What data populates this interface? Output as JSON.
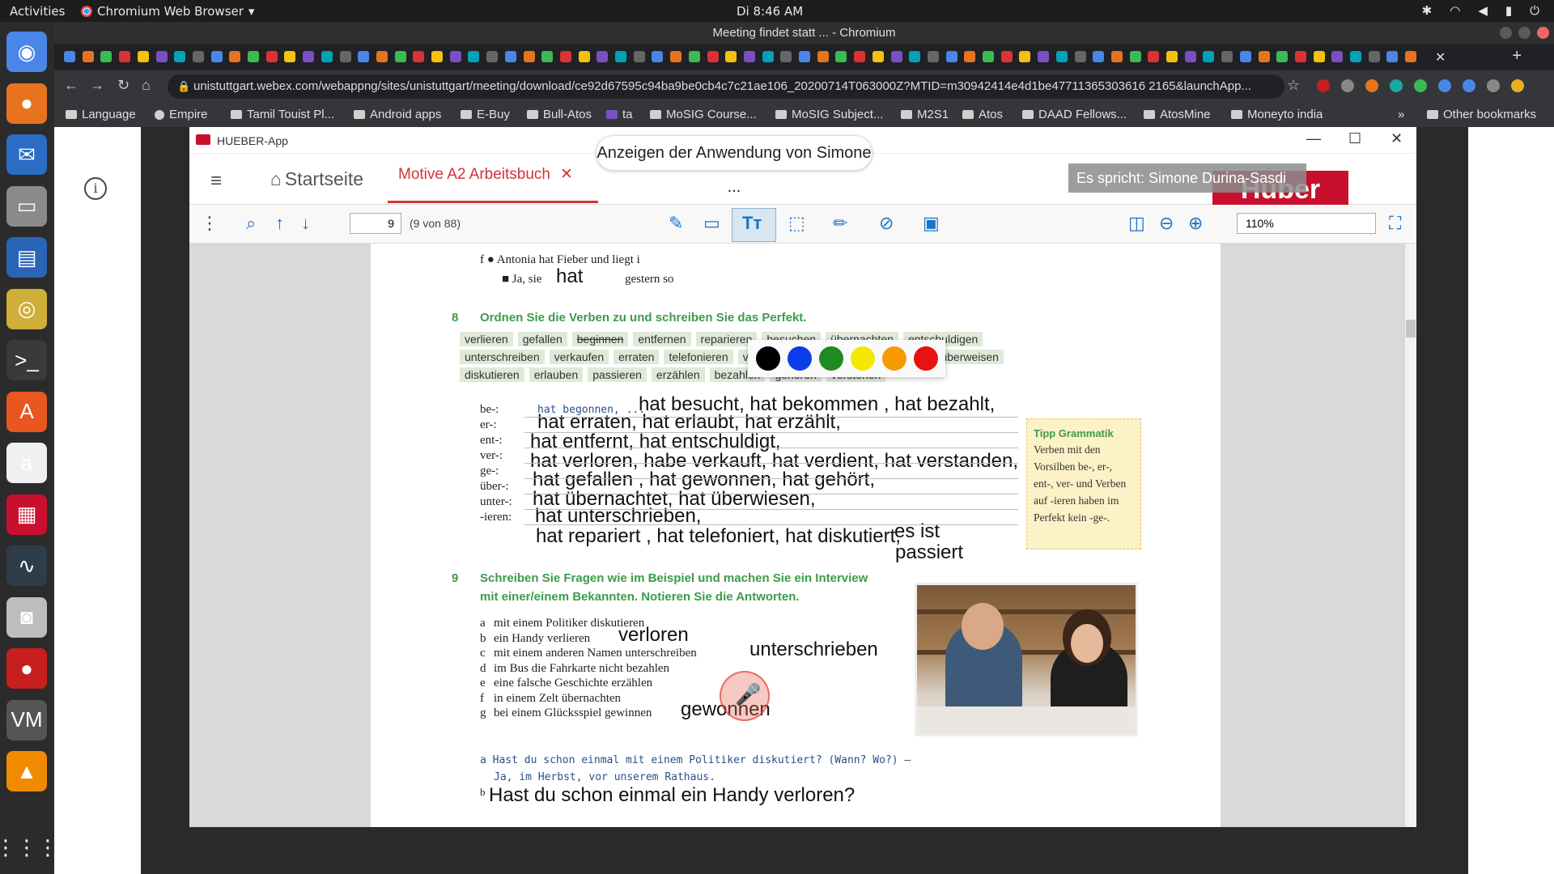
{
  "system": {
    "activities": "Activities",
    "app_name": "Chromium Web Browser",
    "app_dropdown": "▾",
    "clock": "Di  8:46 AM",
    "tray_icons": [
      "bluetooth-icon",
      "wifi-icon",
      "volume-icon",
      "battery-icon",
      "power-icon"
    ],
    "tray_glyphs": [
      "✱",
      "◠",
      "◀",
      "▮",
      "⏻"
    ]
  },
  "dock": {
    "items": [
      {
        "name": "chromium-icon",
        "glyph": "◉",
        "color": "#4a86e8"
      },
      {
        "name": "firefox-icon",
        "glyph": "●",
        "color": "#e8731f"
      },
      {
        "name": "thunderbird-icon",
        "glyph": "✉",
        "color": "#2b6cc4"
      },
      {
        "name": "files-icon",
        "glyph": "▭",
        "color": "#8a8a8a"
      },
      {
        "name": "writer-icon",
        "glyph": "▤",
        "color": "#2a64b8"
      },
      {
        "name": "rhythmbox-icon",
        "glyph": "◎",
        "color": "#cfae3a"
      },
      {
        "name": "terminal-icon",
        "glyph": ">_",
        "color": "#3a3a3a"
      },
      {
        "name": "software-center-icon",
        "glyph": "A",
        "color": "#e8571f"
      },
      {
        "name": "amazon-icon",
        "glyph": "a",
        "color": "#f0f0f0"
      },
      {
        "name": "screen-reader-icon",
        "glyph": "▦",
        "color": "#c8102e"
      },
      {
        "name": "system-monitor-icon",
        "glyph": "∿",
        "color": "#2f3d4a"
      },
      {
        "name": "camera-icon",
        "glyph": "◙",
        "color": "#bdbdbd"
      },
      {
        "name": "cherry-icon",
        "glyph": "●",
        "color": "#c81e1e"
      },
      {
        "name": "vmware-icon",
        "glyph": "VM",
        "color": "#555555"
      },
      {
        "name": "vlc-icon",
        "glyph": "▲",
        "color": "#f08a00"
      },
      {
        "name": "show-apps-icon",
        "glyph": "⋮⋮⋮",
        "color": "#2b2b2b"
      }
    ]
  },
  "browser": {
    "window_title": "Meeting findet statt ... - Chromium",
    "url": "unistuttgart.webex.com/webappng/sites/unistuttgart/meeting/download/ce92d67595c94ba9be0cb4c7c21ae106_20200714T063000Z?MTID=m30942414e4d1be47711365303616 2165&launchApp...",
    "new_tab": "+",
    "tab_close": "✕",
    "nav": {
      "back": "←",
      "forward": "→",
      "reload": "↻",
      "home": "⌂",
      "star": "☆",
      "lock": "🔒"
    },
    "bookmarks": [
      {
        "label": "Language"
      },
      {
        "label": "Empire"
      },
      {
        "label": "Tamil Touist Pl..."
      },
      {
        "label": "Android apps"
      },
      {
        "label": "E-Buy"
      },
      {
        "label": "Bull-Atos"
      },
      {
        "label": "ta"
      },
      {
        "label": "MoSIG Course..."
      },
      {
        "label": "MoSIG Subject..."
      },
      {
        "label": "M2S1"
      },
      {
        "label": "Atos"
      },
      {
        "label": "DAAD Fellows..."
      },
      {
        "label": "AtosMine"
      },
      {
        "label": "Moneyto india"
      }
    ],
    "bookmarks_more": "»",
    "other_bookmarks": "Other bookmarks"
  },
  "webex": {
    "info_icon": "i",
    "share_tooltip": "Anzeigen der Anwendung von Simone ...",
    "speaking": "Es spricht: Simone Durina-Sasdi",
    "mic_glyph": "🎤"
  },
  "hueber": {
    "window_title": "HUEBER-App",
    "controls": {
      "minimize": "—",
      "maximize": "☐",
      "close": "✕"
    },
    "nav": {
      "menu": "≡",
      "home": "Startseite",
      "home_glyph": "⌂",
      "tab_title": "Motive A2 Arbeitsbuch",
      "tab_close": "✕",
      "brand": "Huber"
    },
    "toolbar": {
      "more": "⋮",
      "page_input": "9",
      "page_count": "(9 von 88)",
      "zoom_input": "110%"
    },
    "palette": [
      "#000000",
      "#0a3ee8",
      "#1f8a1f",
      "#f5e800",
      "#f59b00",
      "#e81212"
    ]
  },
  "page": {
    "ex7_f_line1": "f  ●  Antonia hat Fieber und liegt i",
    "ex7_f_line2": "■  Ja, sie",
    "ex7_f_line2_end": "gestern so",
    "ex7_f_hw": "hat",
    "ex8_num": "8",
    "ex8_title": "Ordnen Sie die Verben zu und schreiben Sie das Perfekt.",
    "verbs_row1": [
      "verlieren",
      "gefallen",
      "beginnen",
      "entfernen",
      "reparieren",
      "besuchen",
      "übernachten",
      "entschuldigen"
    ],
    "verbs_row2": [
      "unterschreiben",
      "verkaufen",
      "erraten",
      "telefonieren",
      "verdienen",
      "gewinnen",
      "bekommen",
      "überweisen"
    ],
    "verbs_row3": [
      "diskutieren",
      "erlauben",
      "passieren",
      "erzählen",
      "bezahlen",
      "gehören",
      "verstehen"
    ],
    "prefixes": [
      "be-:",
      "er-:",
      "ent-:",
      "ver-:",
      "ge-:",
      "über-:",
      "unter-:",
      "-ieren:"
    ],
    "example_line": "hat begonnen, ...",
    "hw_be": "hat besucht, hat bekommen , hat bezahlt,",
    "hw_er": "hat erraten, hat erlaubt,  hat erzählt,",
    "hw_ent": "hat entfernt,  hat entschuldigt,",
    "hw_ver": "hat verloren, habe verkauft, hat verdient, hat verstanden,",
    "hw_ge": "hat gefallen , hat gewonnen, hat gehört,",
    "hw_ueber": "hat übernachtet,  hat überwiesen,",
    "hw_unter": "hat unterschrieben,",
    "hw_ieren": "hat repariert , hat telefoniert,  hat diskutiert,",
    "hw_esist": "es ist",
    "hw_passiert": "passiert",
    "tipp_title": "Tipp Grammatik",
    "tipp_text": "Verben mit den Vorsilben be-, er-, ent-, ver- und Verben auf -ieren haben im Perfekt kein -ge-.",
    "ex9_num": "9",
    "ex9_title1": "Schreiben Sie Fragen wie im Beispiel und machen Sie ein Interview",
    "ex9_title2": "mit einer/einem Bekannten. Notieren Sie die Antworten.",
    "ex9_items": [
      {
        "letter": "a",
        "text": "mit einem Politiker diskutieren",
        "hw": ""
      },
      {
        "letter": "b",
        "text": "ein Handy verlieren",
        "hw": "verloren"
      },
      {
        "letter": "c",
        "text": "mit einem anderen Namen unterschreiben",
        "hw": "unterschrieben"
      },
      {
        "letter": "d",
        "text": "im Bus die Fahrkarte nicht bezahlen",
        "hw": ""
      },
      {
        "letter": "e",
        "text": "eine falsche Geschichte erzählen",
        "hw": ""
      },
      {
        "letter": "f",
        "text": "in einem Zelt übernachten",
        "hw": ""
      },
      {
        "letter": "g",
        "text": "bei einem Glücksspiel gewinnen",
        "hw": "gewonnen"
      }
    ],
    "answer_a1": "a  Hast du schon einmal mit einem Politiker diskutiert? (Wann? Wo?) –",
    "answer_a2": "Ja, im Herbst, vor unserem Rathaus.",
    "answer_b_letter": "b",
    "answer_b_hw": "Hast du schon einmal ein Handy verloren?"
  }
}
